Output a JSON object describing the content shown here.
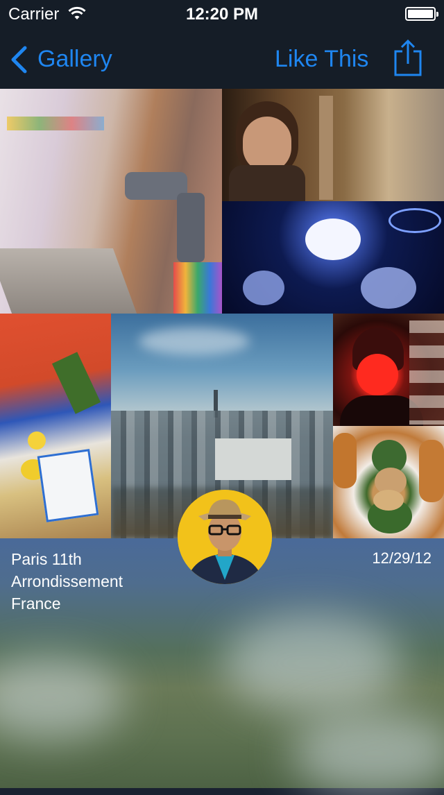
{
  "status_bar": {
    "carrier": "Carrier",
    "time": "12:20 PM",
    "icons": [
      "wifi-icon",
      "battery-icon"
    ]
  },
  "nav": {
    "back_label": "Gallery",
    "like_label": "Like This",
    "icons": [
      "chevron-left-icon",
      "share-icon"
    ],
    "accent_color": "#1f86f0"
  },
  "collage": {
    "photos": [
      "graffiti-faucet-photo",
      "man-portrait-photo",
      "christmas-lights-photo",
      "seafood-market-photo",
      "paris-skyline-photo",
      "red-lit-portrait-photo",
      "escargot-pastries-photo"
    ]
  },
  "info": {
    "location_line1": "Paris 11th",
    "location_line2": "Arrondissement",
    "location_line3": "France",
    "date": "12/29/12"
  }
}
